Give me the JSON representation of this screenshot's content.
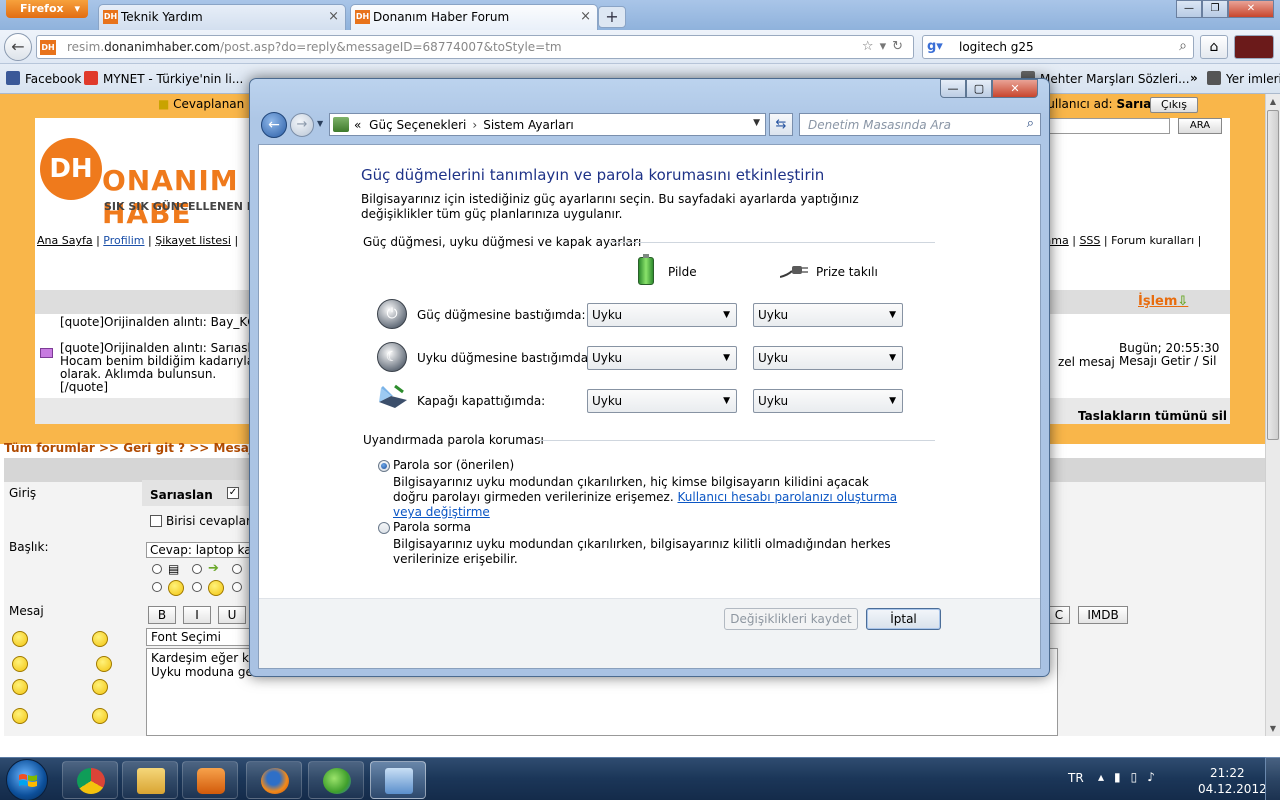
{
  "browser": {
    "menu_button": "Firefox",
    "tabs": [
      {
        "favicon": "DH",
        "label": "Teknik Yardım"
      },
      {
        "favicon": "DH",
        "label": "Donanım Haber Forum"
      }
    ],
    "url_prefix": "resim.",
    "url_domain": "donanimhaber.com",
    "url_path": "/post.asp?do=reply&messageID=68774007&toStyle=tm",
    "search_value": "logitech g25",
    "bookmarks": [
      {
        "label": "Facebook",
        "color": "#3b5998"
      },
      {
        "label": "MYNET - Türkiye'nin li...",
        "color": "#e03a2b"
      },
      {
        "label": "Mehter Marşları Sözleri...",
        "color": "#6b6b6b"
      }
    ],
    "bookmarks_more": "»",
    "other_bookmarks": "Yer imleri"
  },
  "forum": {
    "logo_letters": "DH",
    "logo_name": "ONANIM HABE",
    "logo_slogan": "SIK SIK GÜNCELLENEN HABER S",
    "top_link": "Cevaplanan",
    "user_prefix": "Kullanıcı ad:",
    "username": "Sarıaslan",
    "logout": "Çıkış",
    "search_button": "ARA",
    "nav_left": [
      "Ana Sayfa",
      "Profilim",
      "Şikayet listesi"
    ],
    "nav_right": [
      "rama",
      "SSS",
      "Forum kuralları"
    ],
    "action_link": "İşlem",
    "draft_text": "[quote]Orijinalden alıntı: Bay_KG\n\n[quote]Orijinalden alıntı: Sarıasla\nHocam benim bildiğim kadarıyla b\nolarak. Aklımda bulunsun.\n[/quote]",
    "draft_side": "zel mesaj",
    "draft_time": "Bugün; 20:55:30",
    "draft_action": "Mesajı Getir / Sil",
    "drafts_delete_all": "Taslakların tümünü sil",
    "breadcrumb": "Tüm forumlar >> Geri git ? >> Mesaja",
    "label_login": "Giriş",
    "label_subject": "Başlık:",
    "label_message": "Mesaj",
    "notify_label": "Birisi cevaplarsa",
    "subject_value": "Cevap: laptop ka",
    "format_buttons": [
      "B",
      "I",
      "U"
    ],
    "c_button": "C",
    "imdb_button": "IMDB",
    "font_select": "Font Seçimi",
    "message_body": "Kardeşim eğer ka\nUyku moduna ge"
  },
  "dialog": {
    "breadcrumb_lead": "«",
    "breadcrumb": [
      "Güç Seçenekleri",
      "Sistem Ayarları"
    ],
    "search_placeholder": "Denetim Masasında Ara",
    "title": "Güç düğmelerini tanımlayın ve parola korumasını etkinleştirin",
    "description": "Bilgisayarınız için istediğiniz güç ayarlarını seçin. Bu sayfadaki ayarlarda yaptığınız değişiklikler tüm güç planlarınıza uygulanır.",
    "group1_title": "Güç düğmesi, uyku düğmesi ve kapak ayarları",
    "col_battery": "Pilde",
    "col_plugged": "Prize takılı",
    "rows": [
      {
        "label": "Güç düğmesine bastığımda:",
        "battery": "Uyku",
        "plugged": "Uyku",
        "icon": "power-button-icon"
      },
      {
        "label": "Uyku düğmesine bastığımda:",
        "battery": "Uyku",
        "plugged": "Uyku",
        "icon": "sleep-button-icon"
      },
      {
        "label": "Kapağı kapattığımda:",
        "battery": "Uyku",
        "plugged": "Uyku",
        "icon": "laptop-lid-icon"
      }
    ],
    "group2_title": "Uyandırmada parola koruması",
    "option1_label": "Parola sor (önerilen)",
    "option1_desc": "Bilgisayarınız uyku modundan çıkarılırken, hiç kimse bilgisayarın kilidini açacak doğru parolayı girmeden verilerinize erişemez.",
    "option1_link": "Kullanıcı hesabı parolanızı oluşturma veya değiştirme",
    "option2_label": "Parola sorma",
    "option2_desc": "Bilgisayarınız uyku modundan çıkarılırken, bilgisayarınız kilitli olmadığından herkes verilerinize erişebilir.",
    "selected_option": "Parola sor (önerilen)",
    "save_button": "Değişiklikleri kaydet",
    "cancel_button": "İptal"
  },
  "taskbar": {
    "apps": [
      "chrome-icon",
      "explorer-icon",
      "media-player-icon",
      "firefox-icon",
      "messenger-icon",
      "control-panel-icon"
    ],
    "active_app": "control-panel-icon",
    "language": "TR",
    "time": "21:22",
    "date": "04.12.2012"
  },
  "colors": {
    "forum_orange": "#f9b64a",
    "dialog_title_blue": "#1e3287",
    "link_blue": "#0b56c4"
  }
}
